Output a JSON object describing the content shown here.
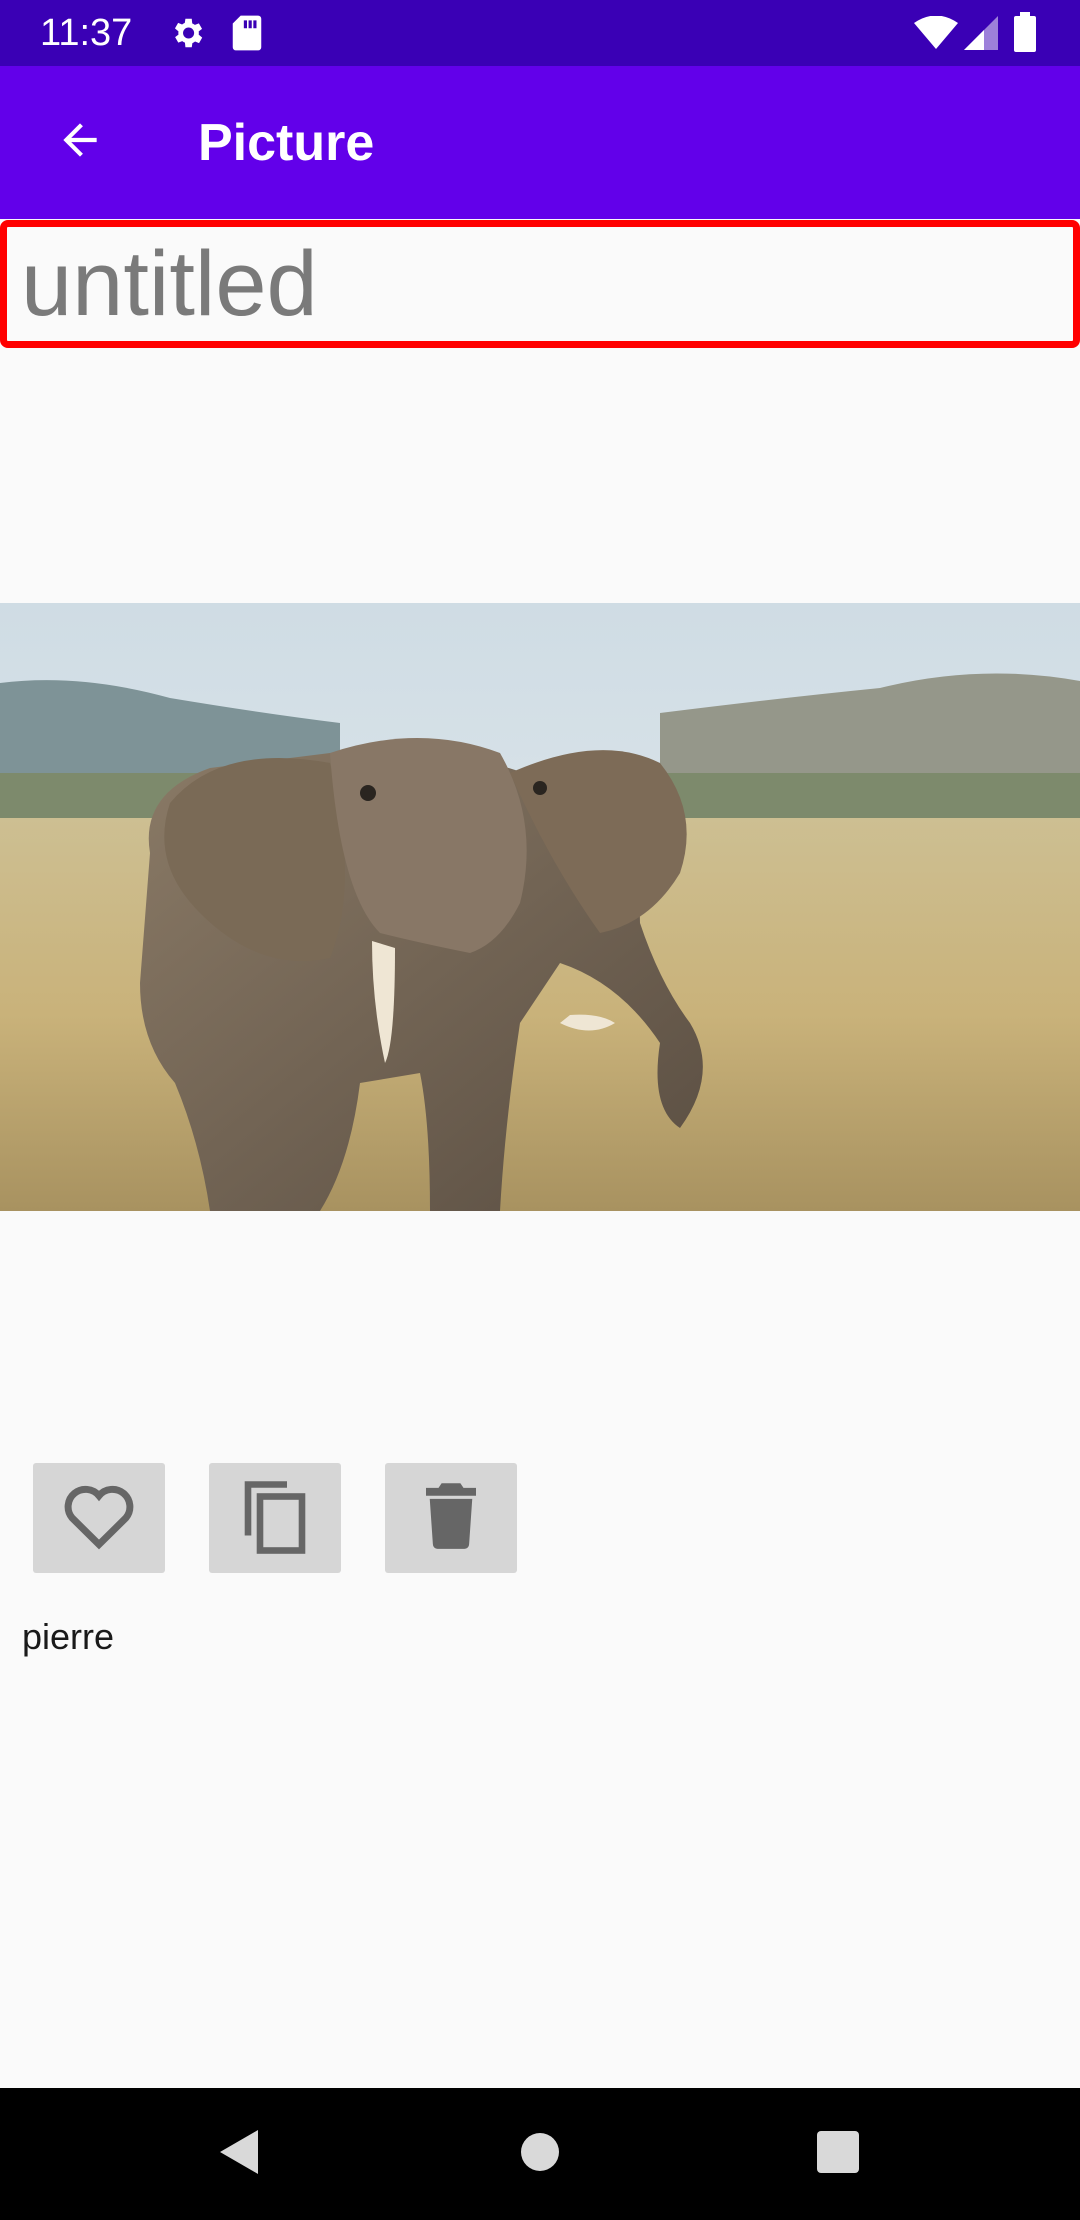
{
  "status_bar": {
    "time": "11:37",
    "icons": [
      "settings-icon",
      "sd-card-icon",
      "wifi-icon",
      "cell-signal-icon",
      "battery-icon"
    ]
  },
  "app_bar": {
    "title": "Picture",
    "back_icon": "arrow-back-icon",
    "color": "#6200ea"
  },
  "title_input": {
    "placeholder": "untitled",
    "value": "",
    "highlight_color": "#ff0000"
  },
  "image": {
    "alt": "elephant"
  },
  "actions": [
    {
      "name": "favorite",
      "icon": "heart-outline-icon"
    },
    {
      "name": "copy",
      "icon": "copy-icon"
    },
    {
      "name": "delete",
      "icon": "trash-icon"
    }
  ],
  "author": "pierre",
  "nav_bar": {
    "icons": [
      "back-triangle-icon",
      "home-circle-icon",
      "recents-square-icon"
    ]
  }
}
